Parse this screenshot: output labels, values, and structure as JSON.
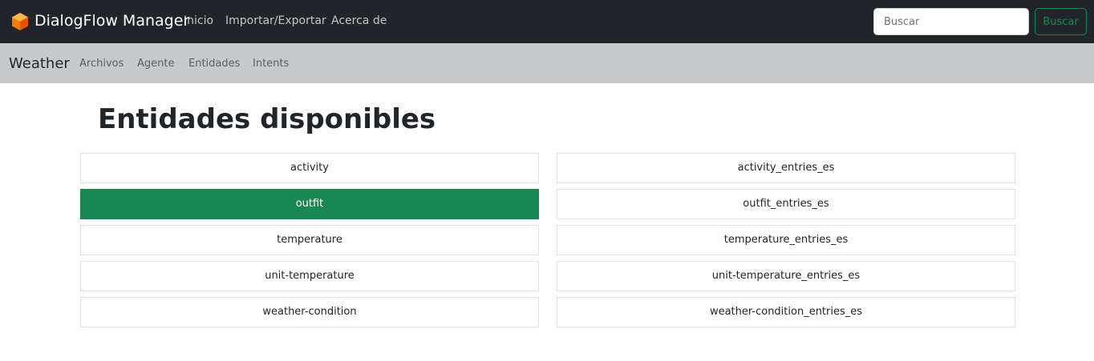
{
  "navbar": {
    "brand": "DialogFlow Manager",
    "links": [
      "Inicio",
      "Importar/Exportar",
      "Acerca de"
    ],
    "search": {
      "placeholder": "Buscar",
      "value": "",
      "button_label": "Buscar"
    }
  },
  "agent_nav": {
    "brand": "Weather",
    "links": [
      "Archivos",
      "Agente",
      "Entidades",
      "Intents"
    ]
  },
  "main": {
    "title": "Entidades disponibles",
    "entities": [
      "activity",
      "outfit",
      "temperature",
      "unit-temperature",
      "weather-condition"
    ],
    "entries": [
      "activity_entries_es",
      "outfit_entries_es",
      "temperature_entries_es",
      "unit-temperature_entries_es",
      "weather-condition_entries_es"
    ],
    "active_entity": "outfit"
  },
  "colors": {
    "navbar_bg": "#212529",
    "subbar_bg": "#c8c9cb",
    "accent": "#198754",
    "logo": "#f57c00"
  }
}
